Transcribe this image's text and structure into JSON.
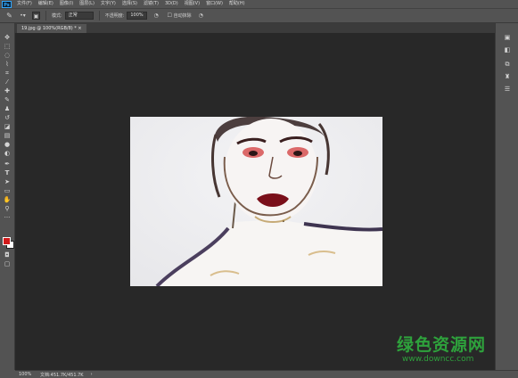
{
  "app": {
    "logo": "Ps"
  },
  "menubar": {
    "items": [
      "文件(F)",
      "编辑(E)",
      "图像(I)",
      "图层(L)",
      "文字(Y)",
      "选择(S)",
      "滤镜(T)",
      "3D(D)",
      "视图(V)",
      "窗口(W)",
      "帮助(H)"
    ]
  },
  "options": {
    "mode_label": "模式:",
    "mode_value": "正常",
    "opacity_label": "不透明度:",
    "opacity_value": "100%",
    "auto_erase_label": "自动抹除"
  },
  "document": {
    "tab_title": "19.jpg @ 100%(RGB/8) *  ×"
  },
  "status": {
    "zoom": "100%",
    "doc_info": "文档:451.7K/451.7K",
    "arrow": "›"
  },
  "watermark": {
    "brand": "绿色资源网",
    "url": "www.downcc.com"
  },
  "icons": {
    "tools": [
      "move-icon",
      "marquee-icon",
      "lasso-icon",
      "quick-select-icon",
      "crop-icon",
      "eyedropper-icon",
      "healing-icon",
      "pencil-icon",
      "stamp-icon",
      "history-brush-icon",
      "eraser-icon",
      "gradient-icon",
      "blur-icon",
      "dodge-icon",
      "pen-icon",
      "type-icon",
      "path-select-icon",
      "shape-icon",
      "hand-icon",
      "zoom-icon"
    ],
    "panels": [
      "layers-icon",
      "adjustments-icon",
      "channels-icon",
      "paths-icon",
      "properties-icon"
    ]
  },
  "colors": {
    "ui": "#535353",
    "canvas_bg": "#282828",
    "foreground": "#d11a1a",
    "background": "#ffffff",
    "watermark": "#2ea23c"
  }
}
